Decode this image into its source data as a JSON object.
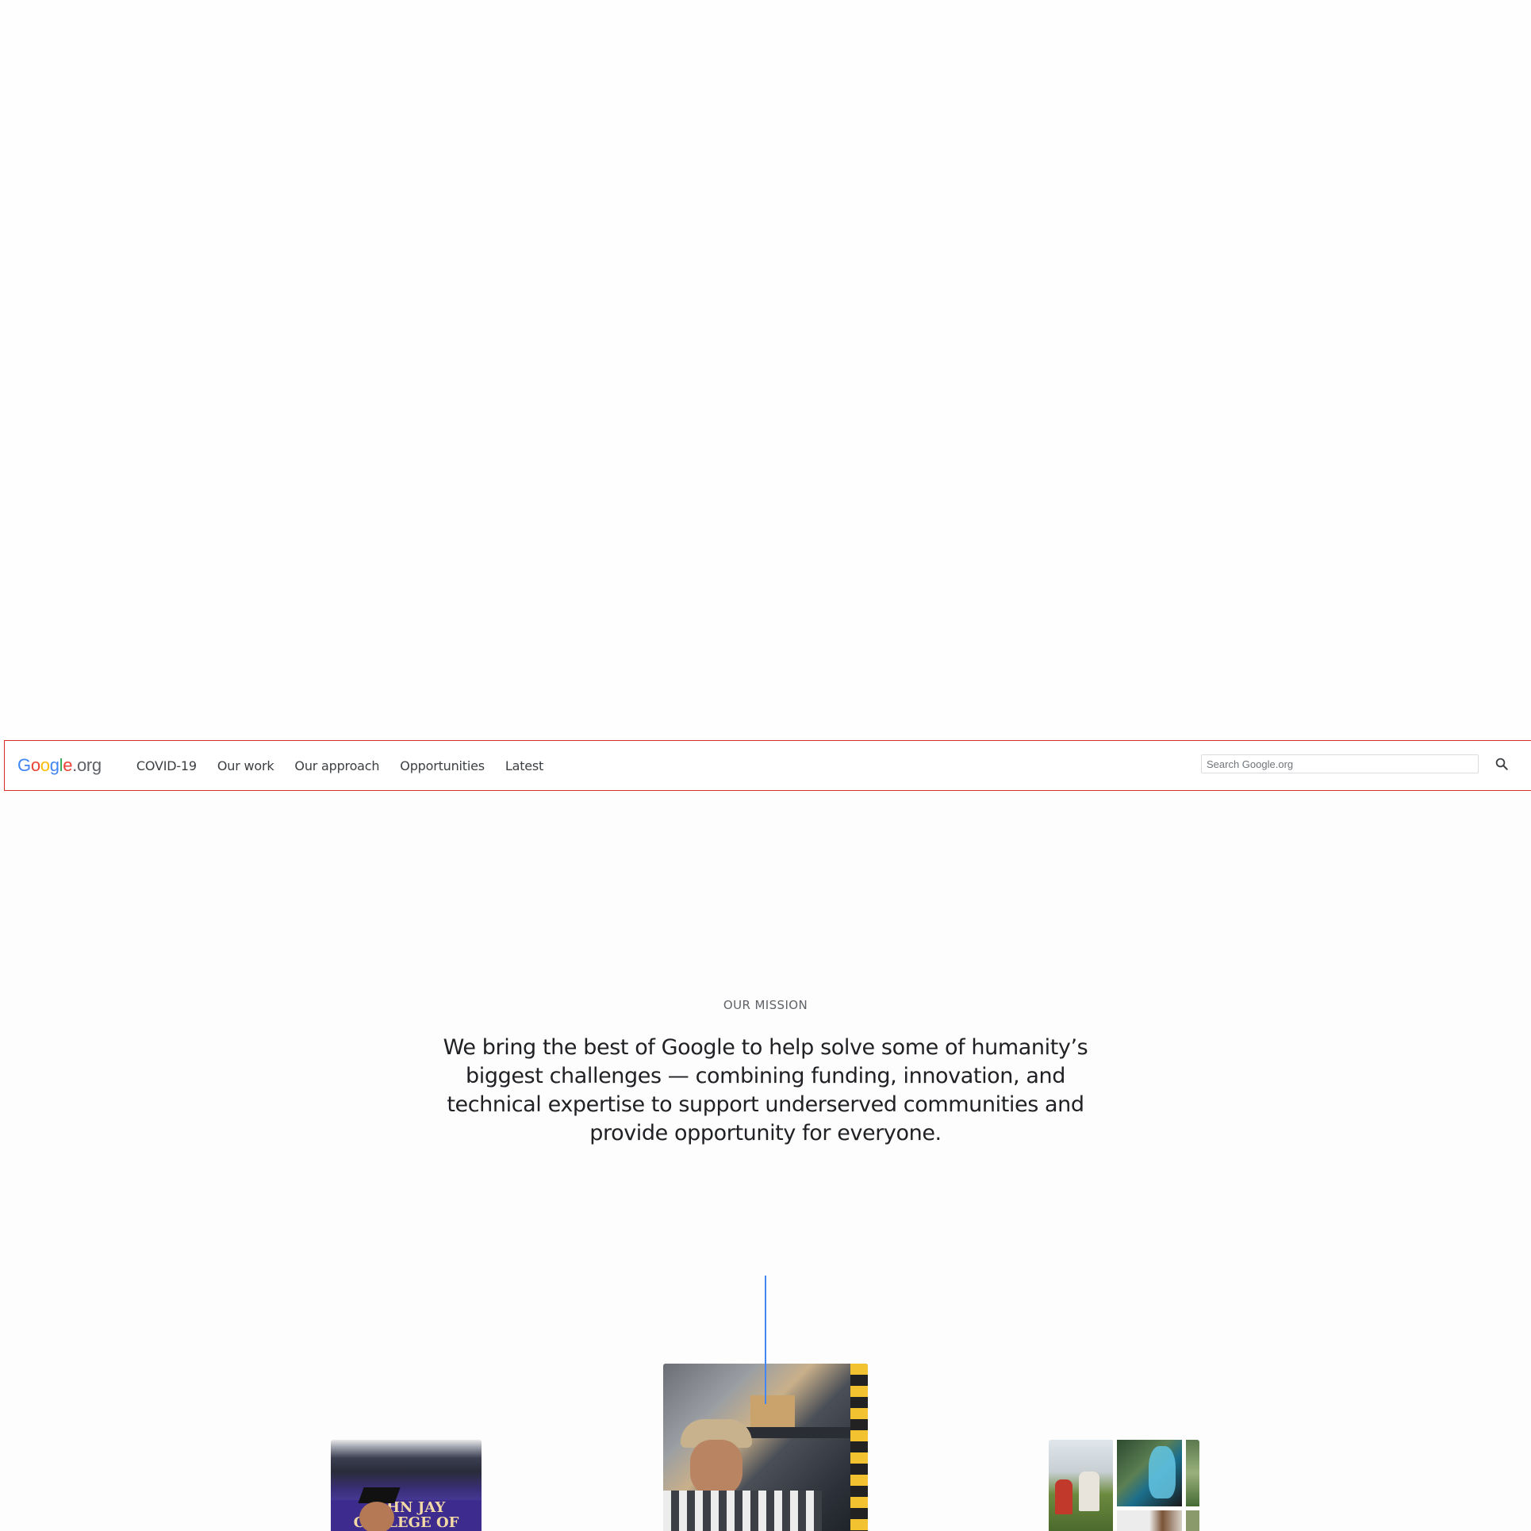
{
  "header": {
    "logo": {
      "letters": [
        "G",
        "o",
        "o",
        "g",
        "l",
        "e"
      ],
      "suffix": ".org",
      "colors": [
        "#4285f4",
        "#ea4335",
        "#fbbc05",
        "#4285f4",
        "#34a853",
        "#ea4335"
      ]
    },
    "nav": [
      {
        "label": "COVID-19"
      },
      {
        "label": "Our work"
      },
      {
        "label": "Our approach"
      },
      {
        "label": "Opportunities"
      },
      {
        "label": "Latest"
      }
    ],
    "search": {
      "placeholder": "Search Google.org",
      "value": ""
    },
    "search_icon": "search-icon"
  },
  "mission": {
    "label": "OUR MISSION",
    "text": "We bring the best of Google to help solve some of humanity’s biggest challenges — combining funding, innovation, and technical expertise to support underserved communities and provide opportunity for everyone."
  },
  "photos": {
    "left": {
      "banner_text": "JOHN JAY COLLEGE OF CRIMINAL JUSTICE"
    }
  },
  "colors": {
    "nav_border": "#d93025",
    "accent_line": "#4285f4",
    "text_primary": "#202124",
    "text_secondary": "#5f6368"
  }
}
